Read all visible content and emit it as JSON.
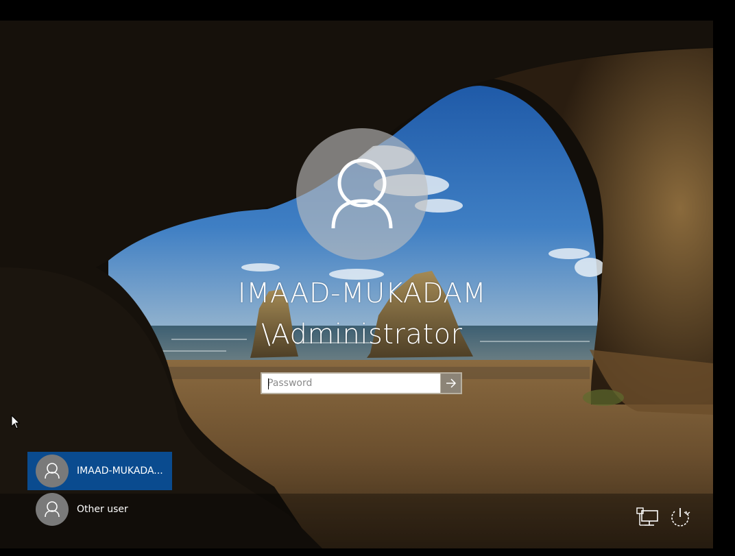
{
  "login": {
    "user_name": "IMAAD-MUKADAM\n\\Administrator",
    "password_placeholder": "Password",
    "submit_icon": "arrow-right-icon",
    "avatar_icon": "user-avatar-icon"
  },
  "users": [
    {
      "label": "IMAAD-MUKADA...",
      "selected": true,
      "icon": "user-avatar-icon"
    },
    {
      "label": "Other user",
      "selected": false,
      "icon": "user-avatar-icon"
    }
  ],
  "corner_buttons": {
    "network_icon": "network-icon",
    "power_icon": "power-icon"
  },
  "colors": {
    "selected_tile": "#0a4b8f",
    "avatar_bg": "#7a7a7a",
    "text": "#ffffff"
  }
}
